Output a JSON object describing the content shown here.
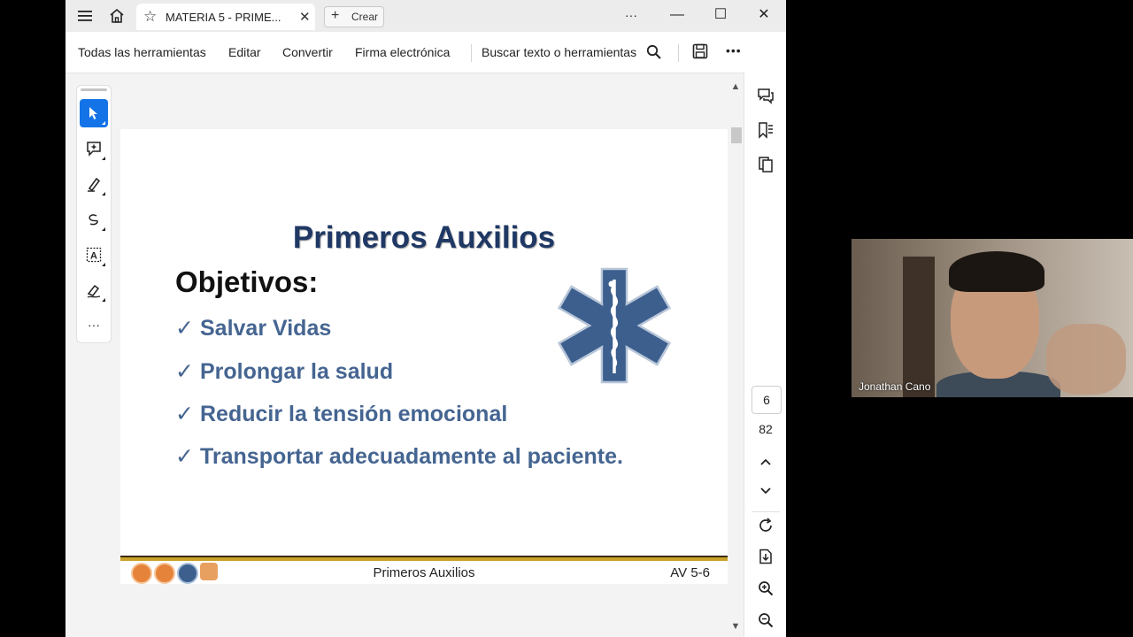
{
  "titlebar": {
    "tab_title": "MATERIA 5 - PRIME...",
    "tab_close": "✕",
    "create_label": "Crear",
    "more": "···",
    "minimize": "—",
    "maximize": "☐",
    "close": "✕"
  },
  "toolbar": {
    "items": [
      "Todas las herramientas",
      "Editar",
      "Convertir",
      "Firma electrónica"
    ],
    "search_label": "Buscar texto o herramientas",
    "more": "•••"
  },
  "left_tools": [
    "select-tool",
    "add-comment-tool",
    "highlight-tool",
    "draw-tool",
    "text-recognition-tool",
    "sign-tool"
  ],
  "left_tools_more": "···",
  "document": {
    "title": "Primeros Auxilios",
    "heading": "Objetivos:",
    "check": "✓",
    "bullets": [
      "Salvar Vidas",
      "Prolongar la salud",
      "Reducir la tensión emocional",
      "Transportar adecuadamente al paciente."
    ],
    "footer_text": "Primeros Auxilios",
    "footer_code": "AV 5-6"
  },
  "right_panel": {
    "current_page": "6",
    "total_pages": "82"
  },
  "video": {
    "participant_name": "Jonathan Cano"
  },
  "colors": {
    "title_blue": "#1f3864",
    "bullet_blue": "#456591",
    "star_of_life": "#3c5f8e",
    "active_tool": "#1473e6"
  }
}
